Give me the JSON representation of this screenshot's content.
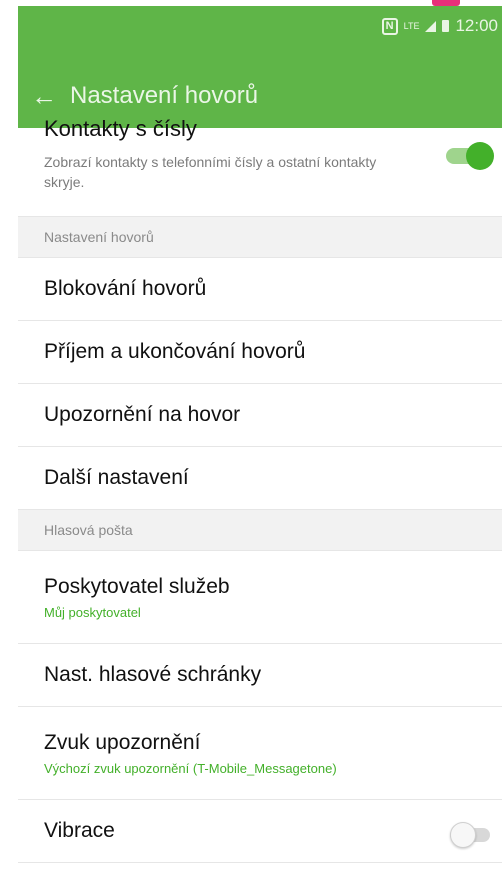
{
  "colors": {
    "accent": "#5fb548",
    "toggle_on": "#43b02a",
    "subtitle_green": "#43b02a"
  },
  "status_bar": {
    "nfc": "N",
    "network": "LTE",
    "time": "12:00"
  },
  "app_bar": {
    "title": "Nastavení hovorů"
  },
  "contacts_with_numbers": {
    "label": "Kontakty s čísly",
    "description": "Zobrazí kontakty s telefonními čísly a ostatní kontakty skryje.",
    "enabled": true
  },
  "sections": {
    "call_settings": "Nastavení hovorů",
    "voicemail": "Hlasová pošta"
  },
  "items": {
    "call_blocking": "Blokování hovorů",
    "answer_end": "Příjem a ukončování hovorů",
    "call_alerts": "Upozornění na hovor",
    "more_settings": "Další nastavení",
    "service_provider": {
      "label": "Poskytovatel služeb",
      "value": "Můj poskytovatel"
    },
    "voicemail_settings": "Nast. hlasové schránky",
    "notification_sound": {
      "label": "Zvuk upozornění",
      "value": "Výchozí zvuk upozornění (T-Mobile_Messagetone)"
    },
    "vibration": {
      "label": "Vibrace",
      "enabled": false
    }
  }
}
